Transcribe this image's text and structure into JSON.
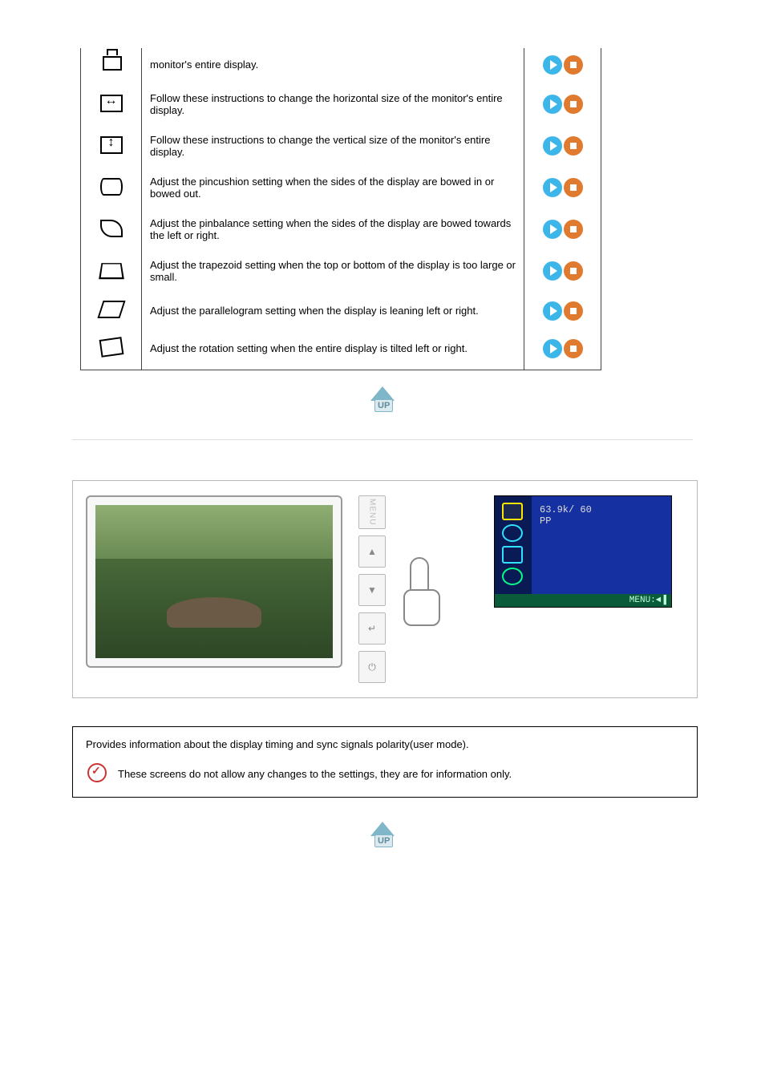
{
  "settings": [
    {
      "iconClass": "geom-vpos",
      "name": "vertical-position-icon",
      "desc": "monitor's entire display."
    },
    {
      "iconClass": "geom-hsize",
      "name": "horizontal-size-icon",
      "desc": "Follow these instructions to change the horizontal size of the monitor's entire display."
    },
    {
      "iconClass": "geom-vsize",
      "name": "vertical-size-icon",
      "desc": "Follow these instructions to change the vertical size of the monitor's entire display."
    },
    {
      "iconClass": "geom-pincushion",
      "name": "pincushion-icon",
      "desc": "Adjust the pincushion setting when the sides of the display are bowed in or bowed out."
    },
    {
      "iconClass": "geom-pinbalance",
      "name": "pinbalance-icon",
      "desc": "Adjust the pinbalance setting when the sides of the display are bowed towards the left or right."
    },
    {
      "iconClass": "geom-trapezoid",
      "name": "trapezoid-icon",
      "desc": "Adjust the trapezoid setting when the top or bottom of the display is too large or small."
    },
    {
      "iconClass": "geom-parallel",
      "name": "parallelogram-icon",
      "desc": "Adjust the parallelogram setting when the display is leaning left or right."
    },
    {
      "iconClass": "geom-rotate",
      "name": "rotation-icon",
      "desc": "Adjust the rotation setting when the entire display is tilted left or right."
    }
  ],
  "controls": {
    "menu": "MENU",
    "up": "▲",
    "down": "▼",
    "enter": "↵",
    "power": "⏻"
  },
  "osd": {
    "line1": "63.9k/ 60",
    "line2": "PP",
    "footer": "MENU:◄▐"
  },
  "info": {
    "heading": "Provides information about the display timing and sync signals polarity(user mode).",
    "note": "These screens do not allow any changes to the settings, they are for information only."
  }
}
